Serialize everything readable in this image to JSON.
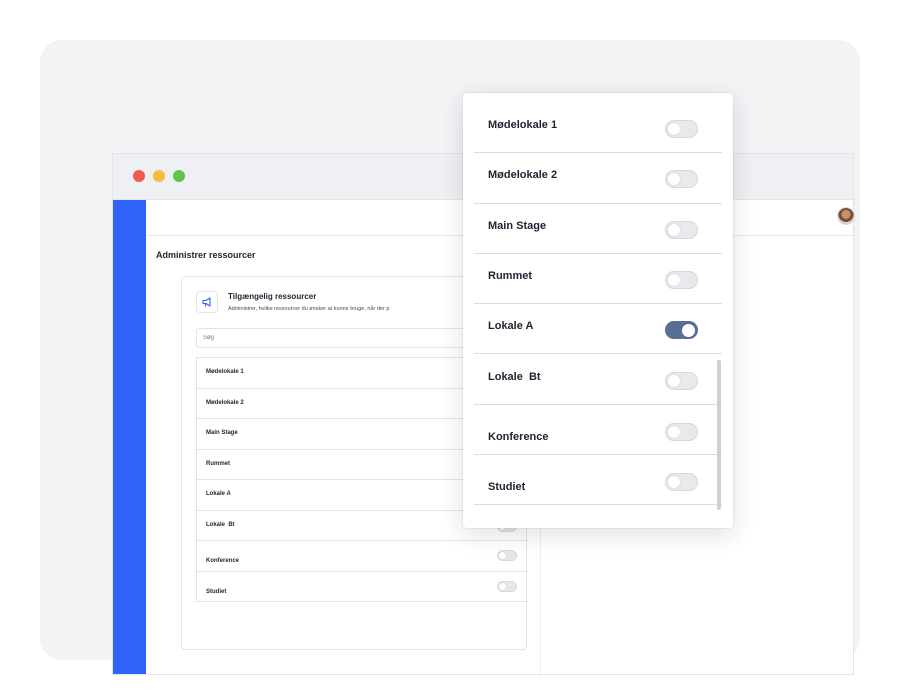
{
  "window": {
    "controls": [
      "close",
      "minimize",
      "maximize"
    ]
  },
  "page": {
    "title": "Administrer ressourcer"
  },
  "card": {
    "icon": "megaphone-icon",
    "title": "Tilgængelig ressourcer",
    "description": "Administrer, hvilke ressourcer du ønsker at kunne bruge, når der p",
    "search_placeholder": "Søg"
  },
  "resources": [
    {
      "label": "Mødelokale 1",
      "enabled": false
    },
    {
      "label": "Mødelokale 2",
      "enabled": false
    },
    {
      "label": "Main Stage",
      "enabled": false
    },
    {
      "label": "Rummet",
      "enabled": false
    },
    {
      "label": "Lokale A",
      "enabled": true
    },
    {
      "label": "Lokale  Bt",
      "enabled": false
    },
    {
      "label": "Konference",
      "enabled": false
    },
    {
      "label": "Studiet",
      "enabled": false
    }
  ],
  "colors": {
    "sidebar": "#2d63f6",
    "toggle_on": "#566f93",
    "toggle_off": "#e8e9ec",
    "close_dot": "#ef5b52",
    "minimize_dot": "#f6bd3b",
    "maximize_dot": "#5ec34f"
  }
}
